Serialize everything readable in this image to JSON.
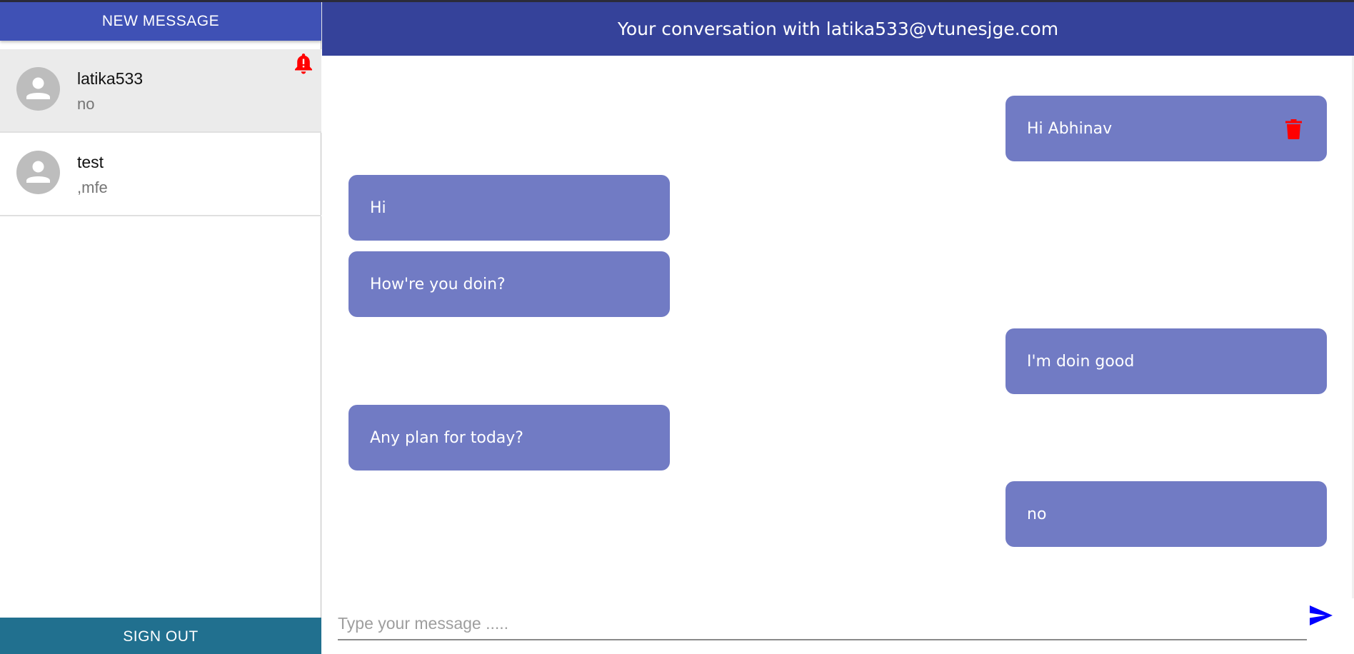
{
  "sidebar": {
    "new_message_label": "NEW MESSAGE",
    "sign_out_label": "SIGN OUT",
    "chats": [
      {
        "name": "latika533",
        "preview": "no",
        "active": true,
        "unread": true
      },
      {
        "name": "test",
        "preview": ",mfe",
        "active": false,
        "unread": false
      }
    ]
  },
  "header": {
    "title": "Your conversation with latika533@vtunesjge.com"
  },
  "messages": [
    {
      "text": "Hi Abhinav",
      "from": "me",
      "deletable": true
    },
    {
      "text": "Hi",
      "from": "them"
    },
    {
      "text": "How're you doin?",
      "from": "them"
    },
    {
      "text": "I'm doin good",
      "from": "me"
    },
    {
      "text": "Any plan for today?",
      "from": "them"
    },
    {
      "text": "no",
      "from": "me"
    }
  ],
  "composer": {
    "placeholder": "Type your message .....",
    "value": ""
  },
  "icons": {
    "avatar": "person-icon",
    "notification": "bell-alert-icon",
    "delete": "trash-icon",
    "send": "send-icon"
  },
  "colors": {
    "primary": "#3f51b5",
    "header": "#35429a",
    "signout": "#21708f",
    "bubble": "#717bc4",
    "alert": "#ff0000",
    "send": "#0000ff"
  }
}
